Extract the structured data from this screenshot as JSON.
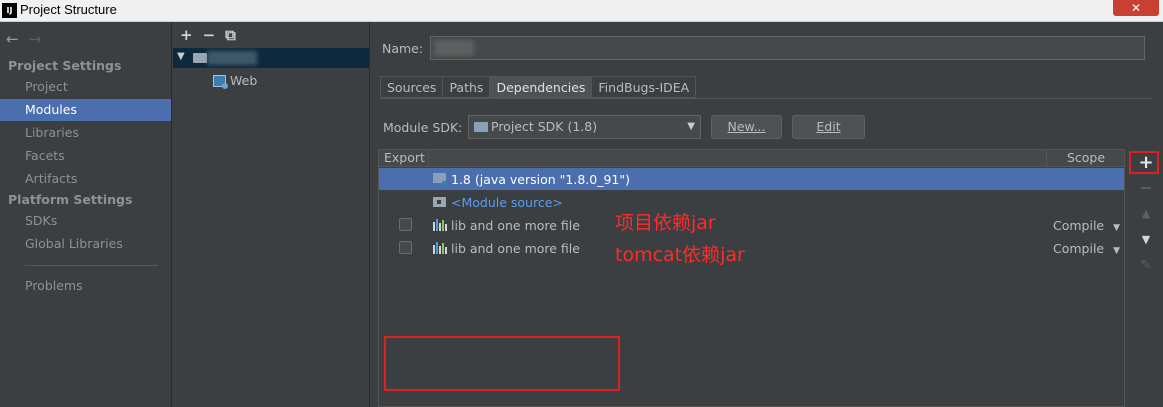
{
  "window": {
    "title": "Project Structure",
    "app_icon_label": "IJ",
    "close_glyph": "✕"
  },
  "nav": {
    "back_glyph": "←",
    "forward_glyph": "→",
    "project_settings_header": "Project Settings",
    "project_items": [
      "Project",
      "Modules",
      "Libraries",
      "Facets",
      "Artifacts"
    ],
    "platform_settings_header": "Platform Settings",
    "platform_items": [
      "SDKs",
      "Global Libraries"
    ],
    "problems": "Problems",
    "selected": "Modules"
  },
  "tree": {
    "add_glyph": "+",
    "remove_glyph": "−",
    "copy_glyph": "⧉",
    "expand_glyph": "▼",
    "web_label": "Web"
  },
  "module": {
    "name_label": "Name:",
    "tabs": [
      "Sources",
      "Paths",
      "Dependencies",
      "FindBugs-IDEA"
    ],
    "active_tab": "Dependencies",
    "sdk_label": "Module SDK:",
    "sdk_value": "Project SDK (1.8)",
    "new_button": "New...",
    "edit_button": "Edit"
  },
  "dependencies": {
    "headers": {
      "export": "Export",
      "scope": "Scope"
    },
    "rows": [
      {
        "label": "1.8 (java version \"1.8.0_91\")",
        "kind": "jdk",
        "selected": true
      },
      {
        "label": "<Module source>",
        "kind": "source"
      },
      {
        "label": "lib and one more file",
        "kind": "library",
        "scope": "Compile",
        "exported": false
      },
      {
        "label": "lib and one more file",
        "kind": "library",
        "scope": "Compile",
        "exported": false
      }
    ]
  },
  "side_toolbar": {
    "add": "+",
    "remove": "−",
    "up": "▲",
    "down": "▼",
    "edit": "✎"
  },
  "annotations": {
    "project_jar": "项目依赖jar",
    "tomcat_jar": "tomcat依赖jar",
    "color": "#ff2a2a"
  },
  "colors": {
    "selection": "#4b6eaf",
    "background": "#3c3f41",
    "highlight_box": "#e02020"
  }
}
